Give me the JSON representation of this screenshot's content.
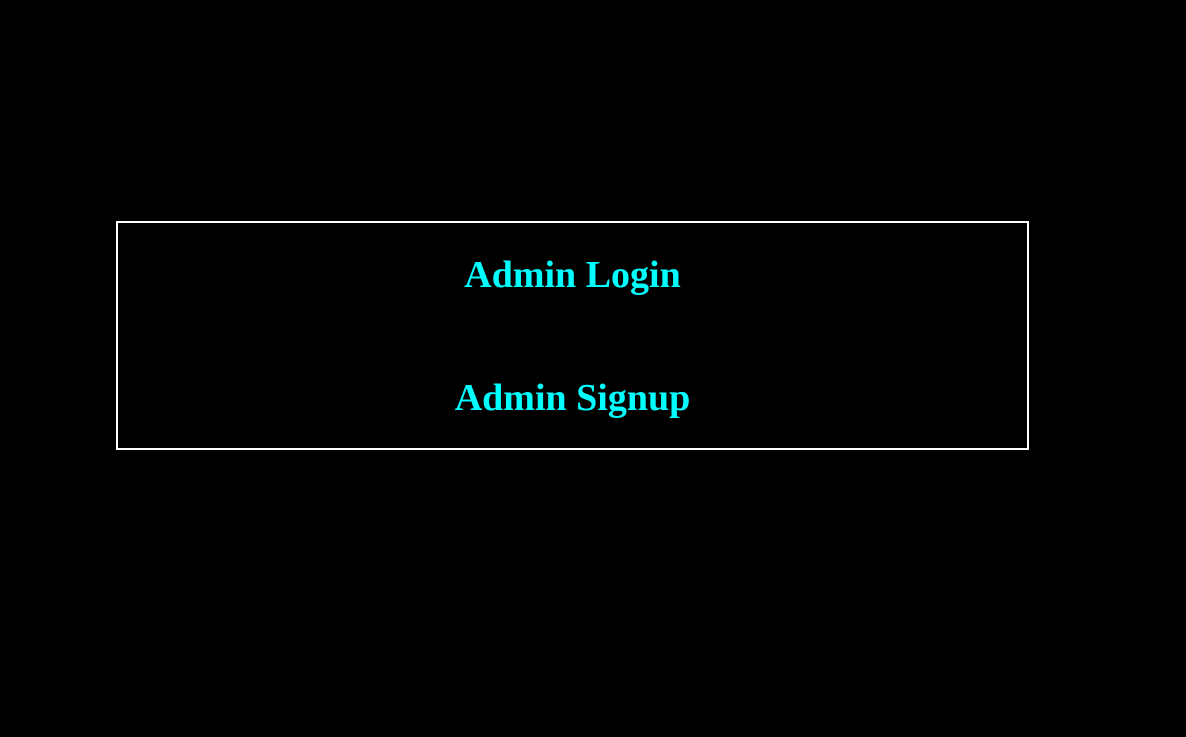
{
  "menu": {
    "login_label": "Admin Login",
    "signup_label": "Admin Signup"
  },
  "colors": {
    "background": "#000000",
    "border": "#ffffff",
    "link": "#00ffff"
  }
}
